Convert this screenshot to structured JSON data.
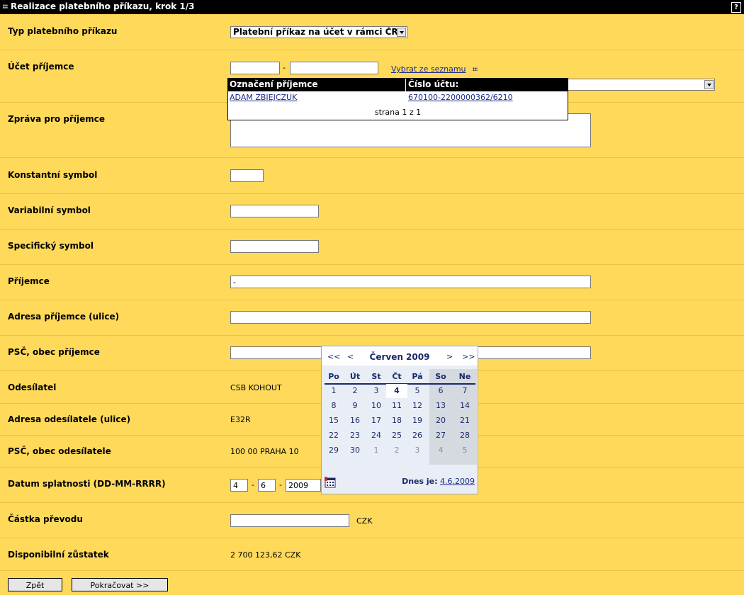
{
  "window": {
    "title": "Realizace platebního příkazu, krok 1/3",
    "help": "?"
  },
  "form": {
    "type": {
      "label": "Typ platebního příkazu",
      "selected": "Platební příkaz na účet v rámci ČR"
    },
    "account": {
      "label": "Účet příjemce",
      "prefix": "",
      "number": "",
      "dash": "-",
      "choose_link": "Vybrat ze seznamu"
    },
    "message": {
      "label": "Zpráva pro příjemce",
      "value": ""
    },
    "constant_symbol": {
      "label": "Konstantní symbol",
      "value": ""
    },
    "variable_symbol": {
      "label": "Variabilní symbol",
      "value": ""
    },
    "specific_symbol": {
      "label": "Specifický symbol",
      "value": ""
    },
    "recipient": {
      "label": "Příjemce",
      "value": "-"
    },
    "recipient_street": {
      "label": "Adresa příjemce (ulice)",
      "value": ""
    },
    "recipient_city": {
      "label": "PSČ, obec příjemce",
      "value": ""
    },
    "sender": {
      "label": "Odesílatel",
      "value": "CSB KOHOUT"
    },
    "sender_street": {
      "label": "Adresa odesílatele (ulice)",
      "value": "E32R"
    },
    "sender_city": {
      "label": "PSČ, obec odesílatele",
      "value": "100 00 PRAHA 10"
    },
    "due_date": {
      "label": "Datum splatnosti (DD-MM-RRRR)",
      "day": "4",
      "month": "6",
      "year": "2009",
      "dash": "-"
    },
    "amount": {
      "label": "Částka převodu",
      "value": "",
      "currency": "CZK"
    },
    "balance": {
      "label": "Disponibilní zůstatek",
      "value": "2 700 123,62 CZK"
    }
  },
  "recipient_list": {
    "col_name": "Označení příjemce",
    "col_account": "Číslo účtu:",
    "rows": [
      {
        "name": "ADAM ZBIEJCZUK",
        "account": "670100-2200000362/6210"
      }
    ],
    "pager": "strana 1 z 1"
  },
  "calendar": {
    "prev_year": "<<",
    "prev_month": "<",
    "next_month": ">",
    "next_year": ">>",
    "month_label": "Červen 2009",
    "weekdays": [
      "Po",
      "Út",
      "St",
      "Čt",
      "Pá",
      "So",
      "Ne"
    ],
    "weeks": [
      [
        "1",
        "2",
        "3",
        "4",
        "5",
        "6",
        "7"
      ],
      [
        "8",
        "9",
        "10",
        "11",
        "12",
        "13",
        "14"
      ],
      [
        "15",
        "16",
        "17",
        "18",
        "19",
        "20",
        "21"
      ],
      [
        "22",
        "23",
        "24",
        "25",
        "26",
        "27",
        "28"
      ],
      [
        "29",
        "30",
        "1",
        "2",
        "3",
        "4",
        "5"
      ]
    ],
    "today_label": "Dnes je:",
    "today_value": "4.6.2009"
  },
  "buttons": {
    "back": "Zpět",
    "continue": "Pokračovat >>"
  },
  "colors": {
    "background": "#FFD95A",
    "titlebar": "#000000",
    "link": "#1a2a8a",
    "calendar_text": "#1a2a6a"
  }
}
